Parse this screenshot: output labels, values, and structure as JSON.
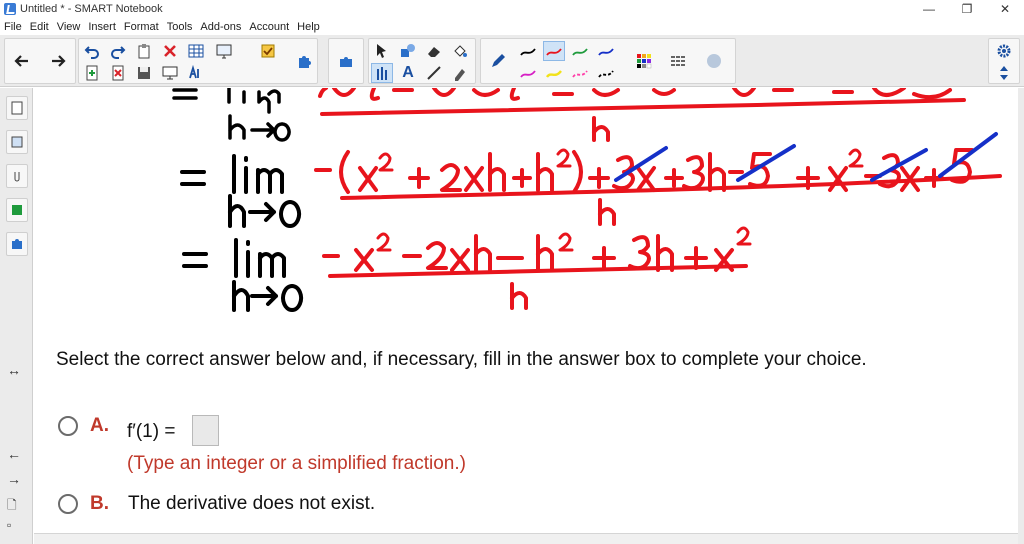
{
  "window": {
    "title": "Untitled * - SMART Notebook",
    "controls": [
      "—",
      "❐",
      "✕"
    ]
  },
  "menu": [
    "File",
    "Edit",
    "View",
    "Insert",
    "Format",
    "Tools",
    "Add-ons",
    "Account",
    "Help"
  ],
  "colors": {
    "ink_red": "#e8141c",
    "ink_blue": "#1530c8",
    "option_letter": "#c0392b"
  },
  "toolbar": {
    "text_tool_label": "A"
  },
  "ink_math": {
    "line2_lhs": "= lim",
    "line2_sub": "h→0",
    "line2_numerator": "−(x² + 2xh + h²) + 3x + 3h − 5 + x² − 3x + 5",
    "line2_denominator": "h",
    "line3_lhs": "= lim",
    "line3_sub": "h→0",
    "line3_numerator": "− x² − 2xh − h² + 3h + x²",
    "line3_denominator": "h"
  },
  "question": {
    "prompt": "Select the correct answer below and, if necessary, fill in the answer box to complete your choice.",
    "options": [
      {
        "letter": "A.",
        "text": "f′(1) =",
        "hint": "(Type an integer or a simplified fraction.)"
      },
      {
        "letter": "B.",
        "text": "The derivative does not exist."
      }
    ]
  }
}
